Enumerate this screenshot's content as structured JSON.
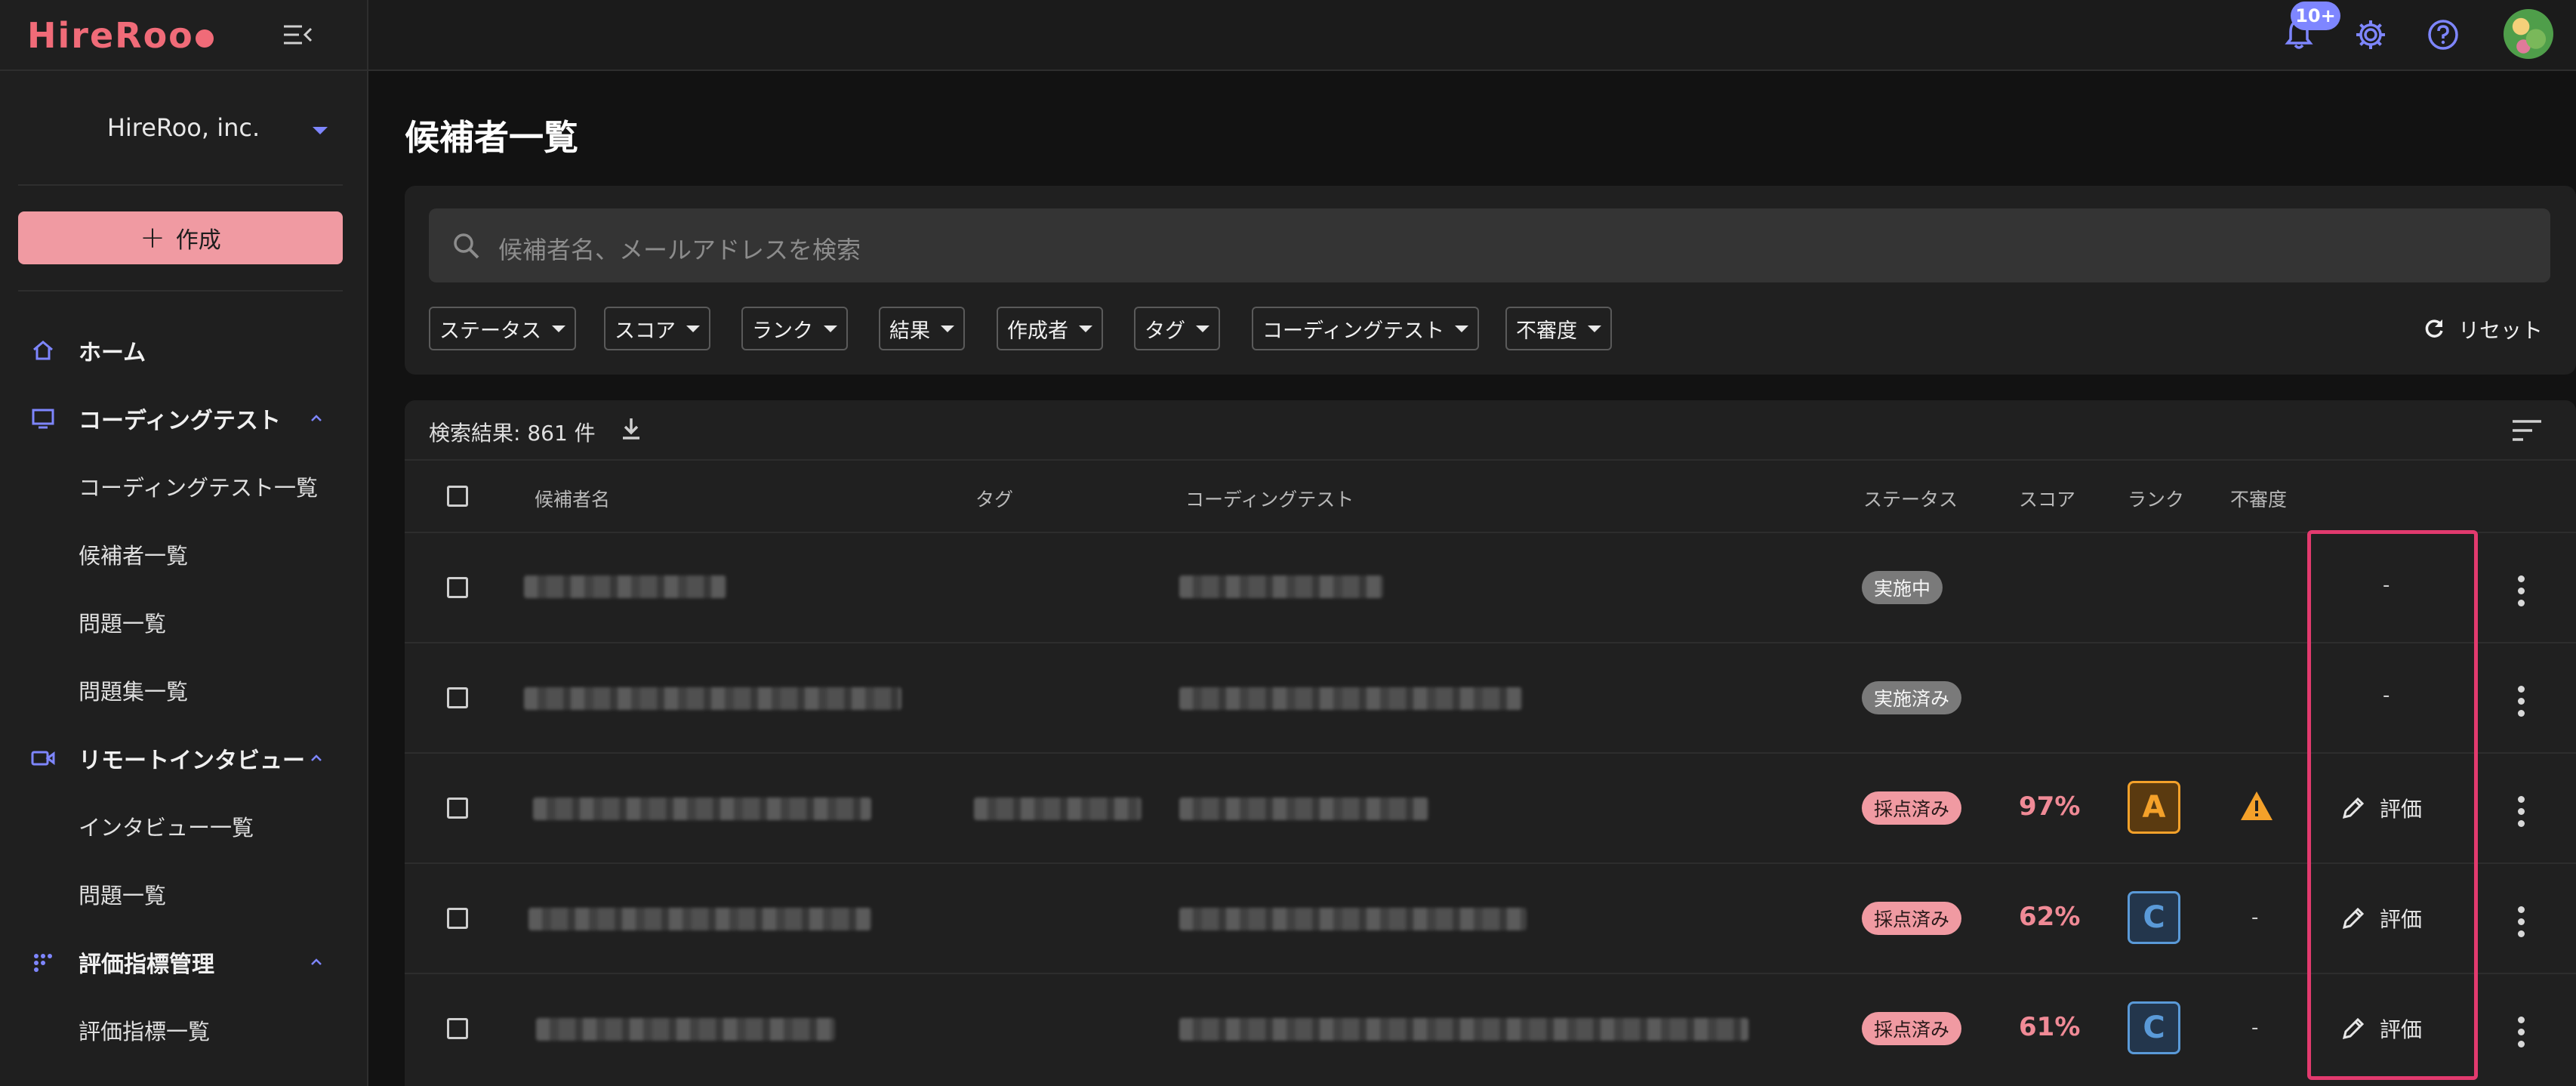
{
  "app": {
    "logo": "HireRoo"
  },
  "sidebar": {
    "org_name": "HireRoo, inc.",
    "create_label": "作成",
    "items": [
      {
        "label": "ホーム",
        "icon": "home-icon"
      },
      {
        "label": "コーディングテスト",
        "icon": "monitor-icon",
        "expanded": true,
        "children": [
          {
            "label": "コーディングテスト一覧"
          },
          {
            "label": "候補者一覧"
          },
          {
            "label": "問題一覧"
          },
          {
            "label": "問題集一覧"
          }
        ]
      },
      {
        "label": "リモートインタビュー",
        "icon": "video-icon",
        "expanded": true,
        "children": [
          {
            "label": "インタビュー一覧"
          },
          {
            "label": "問題一覧"
          }
        ]
      },
      {
        "label": "評価指標管理",
        "icon": "grid-icon",
        "expanded": true,
        "children": [
          {
            "label": "評価指標一覧"
          }
        ]
      }
    ]
  },
  "topbar": {
    "notification_badge": "10+",
    "icons": [
      "bell-icon",
      "gear-icon",
      "help-icon",
      "avatar"
    ]
  },
  "page": {
    "title": "候補者一覧"
  },
  "filters": {
    "search_placeholder": "候補者名、メールアドレスを検索",
    "chips": [
      "ステータス",
      "スコア",
      "ランク",
      "結果",
      "作成者",
      "タグ",
      "コーディングテスト",
      "不審度"
    ],
    "reset_label": "リセット"
  },
  "results": {
    "count_label": "検索結果: 861 件",
    "columns": [
      "候補者名",
      "タグ",
      "コーディングテスト",
      "ステータス",
      "スコア",
      "ランク",
      "不審度"
    ],
    "rows": [
      {
        "status": "実施中",
        "status_type": "gray",
        "score": "",
        "rank": "",
        "suspicion": "",
        "action": "-"
      },
      {
        "status": "実施済み",
        "status_type": "gray",
        "score": "",
        "rank": "",
        "suspicion": "",
        "action": "-"
      },
      {
        "status": "採点済み",
        "status_type": "pink",
        "score": "97%",
        "rank": "A",
        "suspicion": "warning-icon",
        "action": "評価"
      },
      {
        "status": "採点済み",
        "status_type": "pink",
        "score": "62%",
        "rank": "C",
        "suspicion": "-",
        "action": "評価"
      },
      {
        "status": "採点済み",
        "status_type": "pink",
        "score": "61%",
        "rank": "C",
        "suspicion": "-",
        "action": "評価"
      }
    ]
  },
  "colors": {
    "accent": "#f09aa2",
    "brand": "#f06b78",
    "highlight": "#e23a6e",
    "nav_icon": "#7e86ff"
  }
}
